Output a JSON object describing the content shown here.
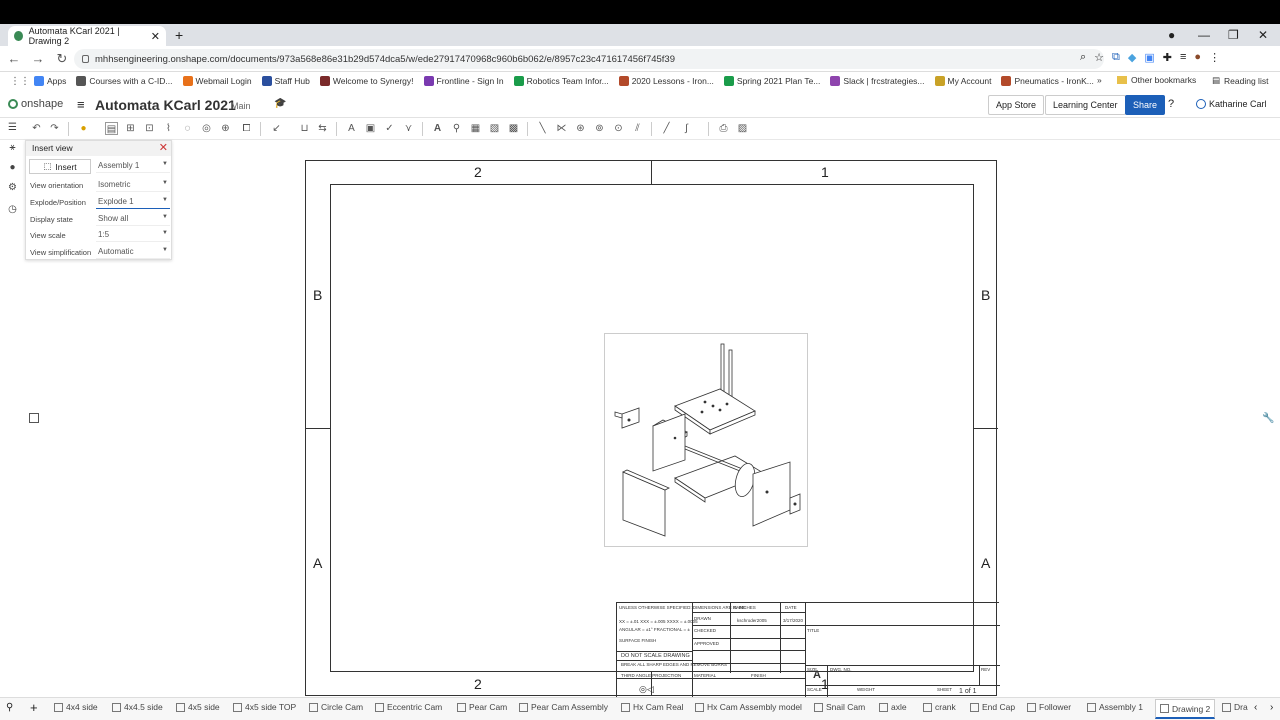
{
  "browser": {
    "tab_title": "Automata KCarl 2021 | Drawing 2",
    "tab_close": "✕",
    "new_tab": "+",
    "win_min": "—",
    "win_restore": "❐",
    "win_close": "✕",
    "back": "←",
    "forward": "→",
    "reload": "↻",
    "url": "mhhsengineering.onshape.com/documents/973a568e86e31b29d574dca5/w/ede27917470968c960b6b062/e/8957c23c471617456f745f39",
    "bookmarks": [
      "Apps",
      "Courses with a C-ID...",
      "Webmail Login",
      "Staff Hub",
      "Welcome to Synergy!",
      "Frontline - Sign In",
      "Robotics Team Infor...",
      "2020 Lessons - Iron...",
      "Spring 2021 Plan Te...",
      "Slack | frcstrategies...",
      "My Account",
      "Pneumatics - IronK..."
    ],
    "bookmark_colors": [
      "#4285f4",
      "#555555",
      "#e8711a",
      "#2b4f9e",
      "#7a2a2a",
      "#7a3ab0",
      "#1a9c4a",
      "#b34a2a",
      "#1a9c4a",
      "#8e44ad",
      "#c9a227",
      "#b34a2a"
    ],
    "more_bookmarks": "»",
    "other_bookmarks": "Other bookmarks",
    "reading_list": "Reading list"
  },
  "app": {
    "logo_text": "onshape",
    "menu_icon": "≡",
    "title": "Automata KCarl 2021",
    "branch": "Main",
    "graduate_icon": "🎓",
    "app_store": "App Store",
    "learning_center": "Learning Center",
    "share": "Share",
    "help": "?",
    "user_name": "Katharine Carl"
  },
  "panel": {
    "title": "Insert view",
    "close": "✕",
    "insert_label": "Insert",
    "insert_value": "Assembly 1",
    "rows": [
      {
        "label": "View orientation",
        "value": "Isometric"
      },
      {
        "label": "Explode/Position",
        "value": "Explode 1"
      },
      {
        "label": "Display state",
        "value": "Show all"
      },
      {
        "label": "View scale",
        "value": "1:5"
      },
      {
        "label": "View simplification",
        "value": "Automatic"
      }
    ]
  },
  "sheet": {
    "col_left": "2",
    "col_right": "1",
    "row_top": "B",
    "row_bottom": "A"
  },
  "title_block": {
    "unless_note": "UNLESS OTHERWISE SPECIFIED: DIMENSIONS ARE IN INCHES",
    "tolerance_note": "XX = ±.01  XXX = ±.005  XXXX = ±.0005",
    "angular_note": "ANGULAR = ±1°  FRACTIONAL = ±",
    "surface_finish": "SURFACE FINISH",
    "do_not_scale": "DO NOT SCALE DRAWING",
    "break_edges": "BREAK ALL SHARP EDGES AND REMOVE BURRS",
    "projection": "THIRD ANGLE PROJECTION",
    "name_hdr": "NAME",
    "date_hdr": "DATE",
    "drawn": "DRAWN",
    "drawn_name": "kschroder2005",
    "drawn_date": "3/17/2020",
    "checked": "CHECKED",
    "approved": "APPROVED",
    "material": "MATERIAL",
    "finish": "FINISH",
    "title_lbl": "TITLE",
    "size_lbl": "SIZE",
    "size_value": "A",
    "dwg_no": "DWG. NO.",
    "rev": "REV",
    "scale": "SCALE",
    "weight": "WEIGHT",
    "sheet_lbl": "SHEET",
    "sheet_value": "1 of 1"
  },
  "bottom_tabs": [
    {
      "label": "4x4 side",
      "active": false
    },
    {
      "label": "4x4.5 side",
      "active": false
    },
    {
      "label": "4x5 side",
      "active": false
    },
    {
      "label": "4x5 side TOP",
      "active": false
    },
    {
      "label": "Circle Cam",
      "active": false
    },
    {
      "label": "Eccentric Cam",
      "active": false
    },
    {
      "label": "Pear Cam",
      "active": false
    },
    {
      "label": "Pear Cam Assembly",
      "active": false
    },
    {
      "label": "Hx Cam Real",
      "active": false
    },
    {
      "label": "Hx Cam Assembly model",
      "active": false
    },
    {
      "label": "Snail Cam",
      "active": false
    },
    {
      "label": "axle",
      "active": false
    },
    {
      "label": "crank",
      "active": false
    },
    {
      "label": "End Cap",
      "active": false
    },
    {
      "label": "Follower",
      "active": false
    },
    {
      "label": "Assembly 1",
      "active": false
    },
    {
      "label": "Drawing 2",
      "active": true
    },
    {
      "label": "Dra",
      "active": false
    }
  ],
  "bottom_add": "+"
}
